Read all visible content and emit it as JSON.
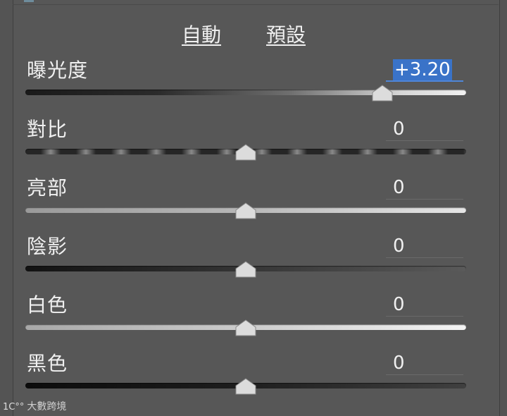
{
  "header": {
    "auto_label": "自動",
    "preset_label": "預設"
  },
  "sliders": [
    {
      "label": "曝光度",
      "value": "+3.20",
      "level": 0.81,
      "selected": true,
      "track": "exposure"
    },
    {
      "label": "對比",
      "value": "0",
      "level": 0.5,
      "selected": false,
      "track": "contrast"
    },
    {
      "label": "亮部",
      "value": "0",
      "level": 0.5,
      "selected": false,
      "track": "highlights"
    },
    {
      "label": "陰影",
      "value": "0",
      "level": 0.5,
      "selected": false,
      "track": "shadows"
    },
    {
      "label": "白色",
      "value": "0",
      "level": 0.5,
      "selected": false,
      "track": "whites"
    },
    {
      "label": "黑色",
      "value": "0",
      "level": 0.5,
      "selected": false,
      "track": "blacks"
    }
  ],
  "watermark": {
    "logo": "1C°°",
    "text": "大數跨境"
  },
  "colors": {
    "panel": "#575757",
    "selection": "#3a73c8",
    "text": "#f0f0f0"
  }
}
